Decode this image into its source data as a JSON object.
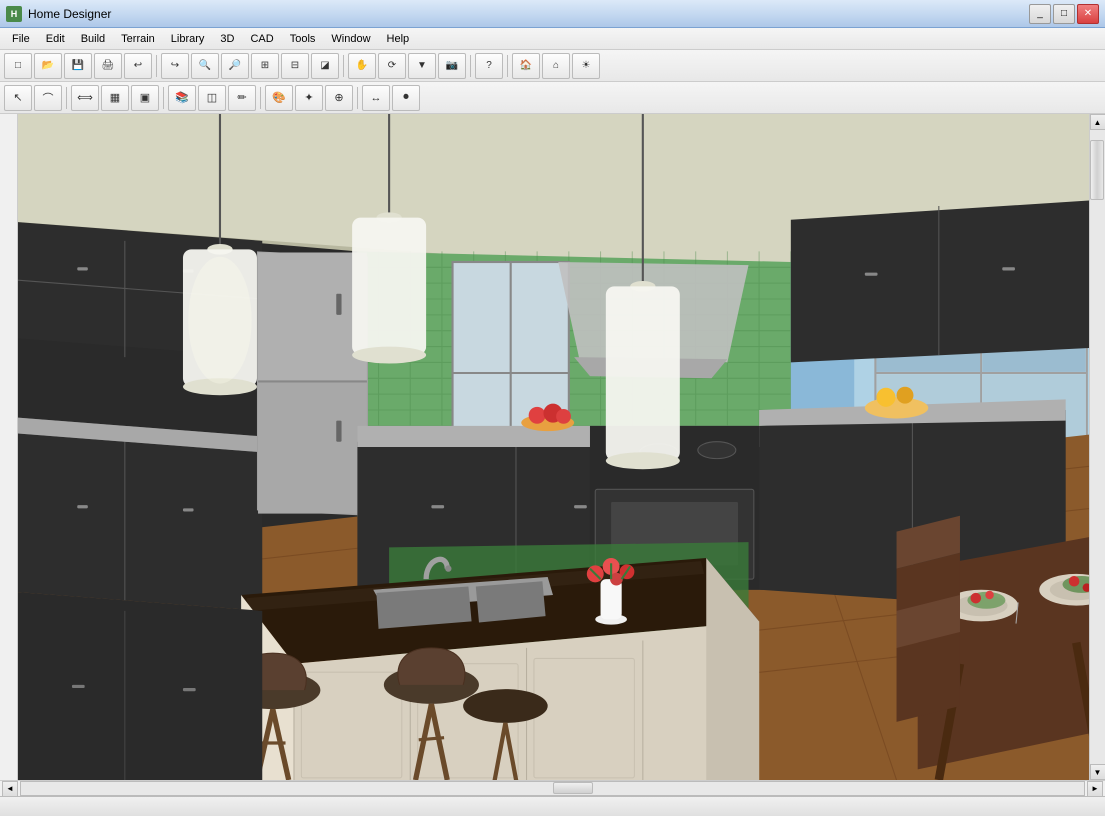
{
  "window": {
    "title": "Home Designer",
    "icon_label": "HD"
  },
  "menu": {
    "items": [
      "File",
      "Edit",
      "Build",
      "Terrain",
      "Library",
      "3D",
      "CAD",
      "Tools",
      "Window",
      "Help"
    ]
  },
  "toolbar1": {
    "buttons": [
      {
        "name": "new",
        "icon": "📄",
        "label": "New"
      },
      {
        "name": "open",
        "icon": "📂",
        "label": "Open"
      },
      {
        "name": "save",
        "icon": "💾",
        "label": "Save"
      },
      {
        "name": "print",
        "icon": "🖨",
        "label": "Print"
      },
      {
        "name": "undo",
        "icon": "↩",
        "label": "Undo"
      },
      {
        "name": "redo",
        "icon": "↪",
        "label": "Redo"
      },
      {
        "name": "zoom-out-btn",
        "icon": "🔍",
        "label": "Zoom Out"
      },
      {
        "name": "zoom-in-btn",
        "icon": "🔎",
        "label": "Zoom In"
      },
      {
        "name": "zoom-extent",
        "icon": "⊞",
        "label": "Zoom Extent"
      },
      {
        "name": "zoom-window",
        "icon": "⊟",
        "label": "Zoom Window"
      },
      {
        "name": "zoom-prev",
        "icon": "◪",
        "label": "Zoom Previous"
      },
      {
        "name": "pan",
        "icon": "✋",
        "label": "Pan"
      },
      {
        "name": "orbit",
        "icon": "↕",
        "label": "Orbit"
      },
      {
        "name": "nav3d",
        "icon": "▼",
        "label": "3D Nav"
      },
      {
        "name": "camera",
        "icon": "📷",
        "label": "Camera"
      },
      {
        "name": "question",
        "icon": "?",
        "label": "Help"
      },
      {
        "name": "house-btn",
        "icon": "🏠",
        "label": "House"
      },
      {
        "name": "roof-btn",
        "icon": "⌂",
        "label": "Roof"
      },
      {
        "name": "sun-btn",
        "icon": "☀",
        "label": "Sun"
      }
    ]
  },
  "toolbar2": {
    "buttons": [
      {
        "name": "select",
        "icon": "↖",
        "label": "Select"
      },
      {
        "name": "polyline",
        "icon": "⌒",
        "label": "Polyline"
      },
      {
        "name": "dimension",
        "icon": "⟺",
        "label": "Dimension"
      },
      {
        "name": "wall-type",
        "icon": "▦",
        "label": "Wall Type"
      },
      {
        "name": "cabinet",
        "icon": "🗄",
        "label": "Cabinet"
      },
      {
        "name": "library",
        "icon": "📚",
        "label": "Library"
      },
      {
        "name": "texture",
        "icon": "◫",
        "label": "Texture"
      },
      {
        "name": "paint",
        "icon": "✏",
        "label": "Paint"
      },
      {
        "name": "material",
        "icon": "🎨",
        "label": "Material"
      },
      {
        "name": "magic-wand",
        "icon": "✦",
        "label": "Magic Wand"
      },
      {
        "name": "move",
        "icon": "⊕",
        "label": "Move"
      },
      {
        "name": "transform",
        "icon": "⊞",
        "label": "Transform"
      },
      {
        "name": "record",
        "icon": "⏺",
        "label": "Record"
      }
    ]
  },
  "viewport": {
    "scene_description": "3D kitchen rendering with dark cabinets, green tile backsplash, wood floors, island with sink"
  },
  "status_bar": {
    "text": ""
  }
}
